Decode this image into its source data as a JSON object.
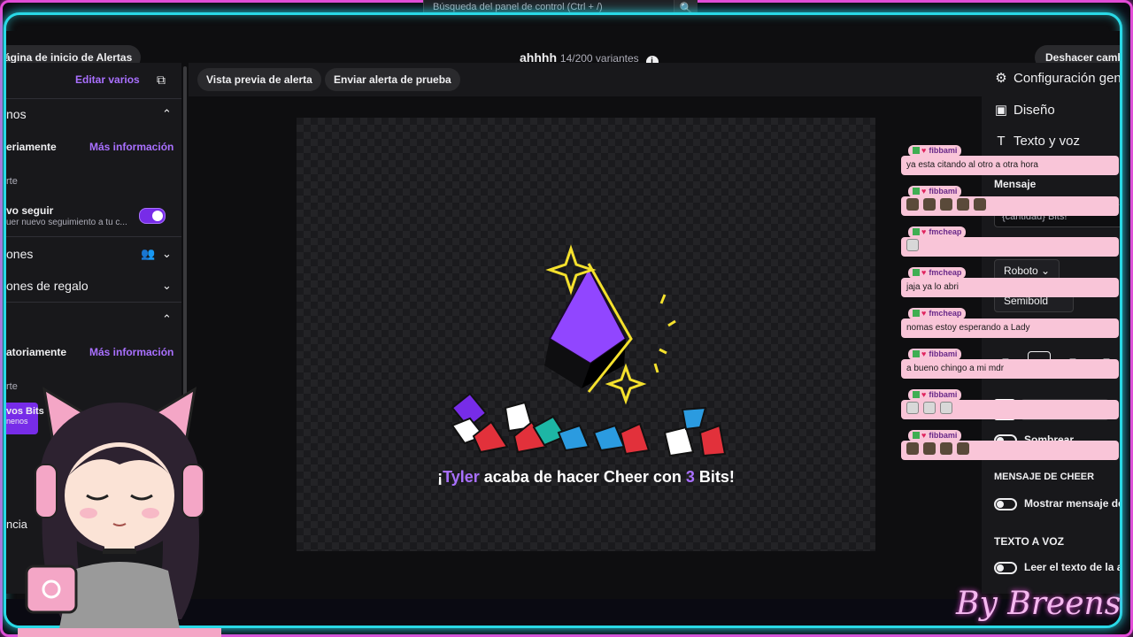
{
  "search": {
    "placeholder": "Búsqueda del panel de control (Ctrl + /)"
  },
  "header": {
    "back_label": "ágina de inicio de Alertas",
    "title": "ahhhh",
    "variant_count": "14/200 variantes",
    "undo_label": "Deshacer cambios"
  },
  "left_panel": {
    "edit_multiple": "Editar varios",
    "section1": "nos",
    "row_random": "eriamente",
    "more_info": "Más información",
    "row_art": "rte",
    "follow_title": "vo seguir",
    "follow_desc": "uer nuevo seguimiento a tu c...",
    "section_subs": "ones",
    "section_gift": "ones de regalo",
    "row_random2": "atoriamente",
    "more_info2": "Más información",
    "row_art2": "rte",
    "bits_label": "vos Bits",
    "bits_sub": "nenos",
    "row_cia": "ncia"
  },
  "toolbar": {
    "preview_label": "Vista previa de alerta",
    "test_label": "Enviar alerta de prueba"
  },
  "alert": {
    "prefix": "¡",
    "user": "Tyler",
    "middle": " acaba de hacer Cheer con ",
    "amount": "3",
    "suffix": " Bits!"
  },
  "right_panel": {
    "general": "Configuración general",
    "design": "Diseño",
    "tts": "Texto y voz",
    "message_label": "Mensaje",
    "message_value": "{cantidad} Bits!",
    "font": "Roboto",
    "weight": "Semibold",
    "color_hex": "#FFFFFF",
    "shadow": "Sombrear",
    "cheer_heading": "MENSAJE DE CHEER",
    "cheer_toggle": "Mostrar mensaje de",
    "tts_heading": "TEXTO A VOZ",
    "tts_toggle": "Leer el texto de la al"
  },
  "chat": [
    {
      "user": "fibbami",
      "text": "ya esta citando al otro a otra hora",
      "emotes": 0
    },
    {
      "user": "fibbami",
      "text": "",
      "emotes": 5
    },
    {
      "user": "fmcheap",
      "text": "",
      "emotes": 1
    },
    {
      "user": "fmcheap",
      "text": "jaja ya lo abri",
      "emotes": 0
    },
    {
      "user": "fmcheap",
      "text": "nomas estoy esperando a Lady",
      "emotes": 0
    },
    {
      "user": "fibbami",
      "text": "a bueno chingo a mi mdr",
      "emotes": 0
    },
    {
      "user": "fibbami",
      "text": "",
      "emotes": 3
    },
    {
      "user": "fibbami",
      "text": "",
      "emotes": 4
    }
  ],
  "signature": "By Breens",
  "colors": {
    "accent": "#a970ff",
    "frame_cyan": "#29d9e6",
    "frame_pink": "#e24bd6",
    "chat_bg": "#f9c5d8"
  }
}
